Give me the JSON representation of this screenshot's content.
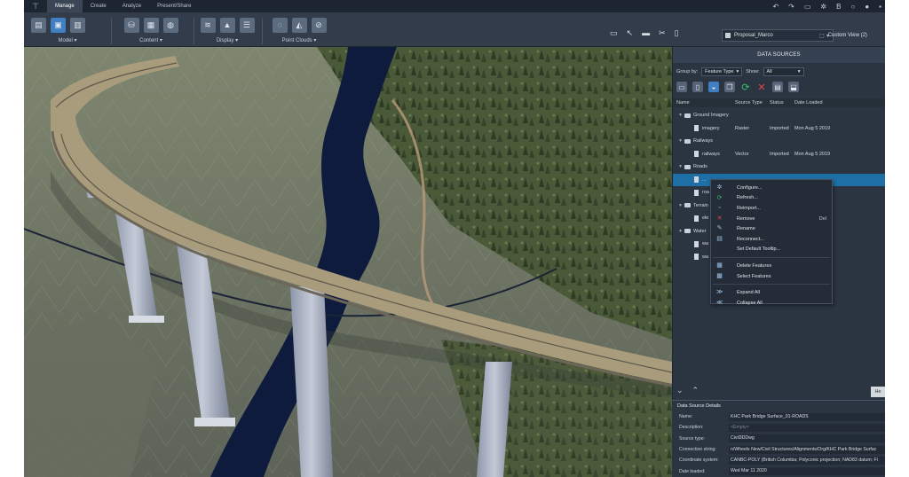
{
  "ribbon_tabs": [
    "Manage",
    "Create",
    "Analyze",
    "Present/Share"
  ],
  "ribbon_groups": {
    "model": "Model",
    "content": "Content",
    "display": "Display",
    "point_clouds": "Point Clouds"
  },
  "proposal": "Proposal_Marco",
  "custom_view": "Custom View (2)",
  "panel": {
    "title": "DATA SOURCES",
    "group_by_label": "Group by:",
    "group_by_value": "Feature Type",
    "show_label": "Show:",
    "show_value": "All",
    "columns": [
      "Name",
      "Source Type",
      "Status",
      "Date Loaded"
    ]
  },
  "tree": [
    {
      "kind": "group",
      "name": "Ground Imagery"
    },
    {
      "kind": "item",
      "name": "imagery",
      "type": "Raster",
      "status": "Imported",
      "date": "Mon Aug 5 2019"
    },
    {
      "kind": "group",
      "name": "Railways"
    },
    {
      "kind": "item",
      "name": "railways",
      "type": "Vector",
      "status": "Imported",
      "date": "Mon Aug 5 2019"
    },
    {
      "kind": "group",
      "name": "Roads"
    },
    {
      "kind": "item",
      "name": "...",
      "type": "",
      "status": "",
      "date": "",
      "selected": true
    },
    {
      "kind": "item",
      "name": "roa",
      "type": "",
      "status": "",
      "date": ""
    },
    {
      "kind": "group",
      "name": "Terrain"
    },
    {
      "kind": "item",
      "name": "ele",
      "type": "",
      "status": "",
      "date": ""
    },
    {
      "kind": "group",
      "name": "Water"
    },
    {
      "kind": "item",
      "name": "wa",
      "type": "",
      "status": "",
      "date": ""
    },
    {
      "kind": "item",
      "name": "wa",
      "type": "",
      "status": "",
      "date": ""
    }
  ],
  "context_menu": [
    {
      "label": "Configure...",
      "icon": "gear-icon"
    },
    {
      "label": "Refresh...",
      "icon": "refresh-icon"
    },
    {
      "label": "Reimport...",
      "icon": "reimport-icon"
    },
    {
      "label": "Remove",
      "icon": "remove-icon",
      "shortcut": "Del"
    },
    {
      "label": "Rename",
      "icon": "rename-icon"
    },
    {
      "label": "Reconnect...",
      "icon": "reconnect-icon"
    },
    {
      "label": "Set Default Tooltip...",
      "icon": ""
    },
    {
      "label": "Delete Features",
      "icon": "delete-features-icon",
      "separator_before": true
    },
    {
      "label": "Select Features",
      "icon": "select-features-icon"
    },
    {
      "label": "Expand All",
      "icon": "expand-all-icon",
      "separator_before": true
    },
    {
      "label": "Collapse All",
      "icon": "collapse-all-icon"
    }
  ],
  "details": {
    "title": "Data Source Details",
    "button": "He",
    "rows": [
      {
        "label": "Name:",
        "value": "KHC Park Bridge Surface_01-ROADS"
      },
      {
        "label": "Description:",
        "value": "<Empty>"
      },
      {
        "label": "Source type:",
        "value": "Civil3DDwg"
      },
      {
        "label": "Connection string:",
        "value": "n/Wheels New/Civil Structures/Alignments/Org/KHC Park Bridge Surfac"
      },
      {
        "label": "Coordinate system:",
        "value": "CANBC-POLY (British Columbia; Polyconic projection; NAD83 datum; Fi"
      },
      {
        "label": "Date loaded:",
        "value": "Wed Mar 11 2020"
      }
    ]
  }
}
